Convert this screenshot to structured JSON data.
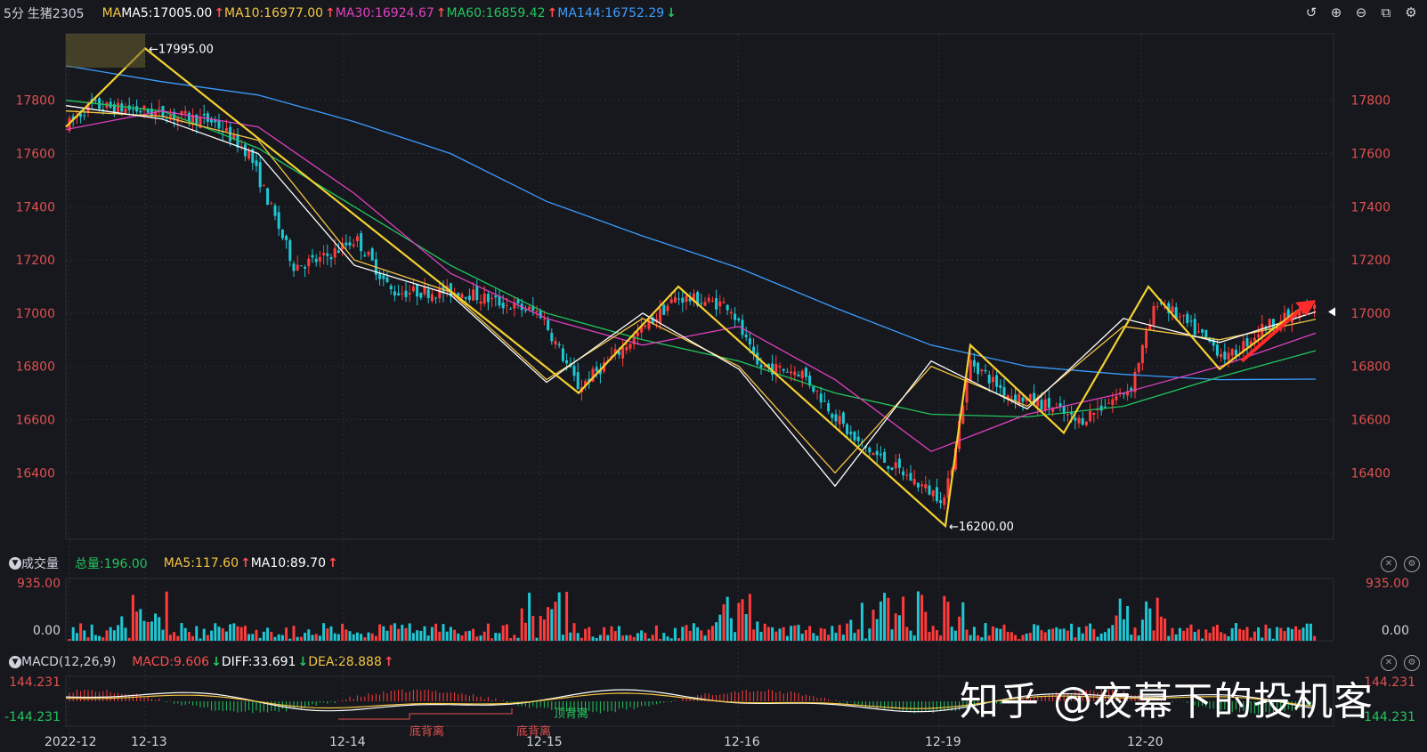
{
  "header": {
    "interval": "5分",
    "symbol": "生猪2305",
    "ma_label": "MA",
    "ma5": "MA5:17005.00",
    "ma10": "MA10:16977.00",
    "ma30": "MA30:16924.67",
    "ma60": "MA60:16859.42",
    "ma144": "MA144:16752.29",
    "ma5_dir": "↑",
    "ma10_dir": "↑",
    "ma30_dir": "↑",
    "ma60_dir": "↑",
    "ma144_dir": "↓"
  },
  "toolbar": {
    "undo_icon": "↺",
    "zoom_in_icon": "⊕",
    "zoom_out_icon": "⊖",
    "layout_icon": "⧉",
    "settings_icon": "⚙"
  },
  "volume_panel": {
    "title": "成交量",
    "total": "总量:196.00",
    "ma5": "MA5:117.60",
    "ma10": "MA10:89.70",
    "ma5_dir": "↑",
    "ma10_dir": "↑",
    "ytop": "935.00",
    "ybottom": "0.00"
  },
  "macd_panel": {
    "title": "MACD(12,26,9)",
    "macd": "MACD:9.606",
    "diff": "DIFF:33.691",
    "dea": "DEA:28.888",
    "macd_dir": "↓",
    "diff_dir": "↓",
    "dea_dir": "↑",
    "ytop": "144.231",
    "ybottom": "-144.231",
    "annotations": [
      "底背离",
      "底背离",
      "顶背离"
    ]
  },
  "price_annotations": {
    "high": "17995.00",
    "low": "16200.00"
  },
  "watermark": "知乎 @夜幕下的投机客",
  "chart_data": {
    "type": "line",
    "title": "生猪2305 5分",
    "y_ticks": [
      17800,
      17600,
      17400,
      17200,
      17000,
      16800,
      16600,
      16400
    ],
    "ylim": [
      16200,
      17995
    ],
    "x_ticks": [
      "2022-12",
      "12-13",
      "12-14",
      "12-15",
      "12-16",
      "12-19",
      "12-20"
    ],
    "zigzag": {
      "x": [
        "12-12 start",
        "12-13 high",
        "12-15 low",
        "12-15 high",
        "12-16 low",
        "12-19 low",
        "12-19 high",
        "12-19 low2",
        "12-20 high",
        "12-20 low",
        "12-20 end"
      ],
      "values": [
        17700,
        17995,
        16700,
        17100,
        16200,
        16200,
        16880,
        16550,
        17100,
        16790,
        17040
      ]
    },
    "series": [
      {
        "name": "MA144",
        "color": "#3b9cff",
        "values": [
          17930,
          17870,
          17820,
          17720,
          17600,
          17420,
          17290,
          17170,
          17020,
          16880,
          16800,
          16770,
          16750,
          16752
        ]
      },
      {
        "name": "MA60",
        "color": "#22c55e",
        "values": [
          17800,
          17760,
          17620,
          17400,
          17180,
          17000,
          16900,
          16820,
          16700,
          16620,
          16610,
          16650,
          16760,
          16859
        ]
      },
      {
        "name": "MA30",
        "color": "#e040c0",
        "values": [
          17690,
          17760,
          17700,
          17450,
          17150,
          16980,
          16880,
          16950,
          16750,
          16480,
          16620,
          16700,
          16800,
          16925
        ]
      },
      {
        "name": "MA10",
        "color": "#f5c542",
        "values": [
          17760,
          17740,
          17650,
          17200,
          17080,
          16750,
          16980,
          16800,
          16400,
          16800,
          16650,
          16950,
          16900,
          16977
        ]
      },
      {
        "name": "MA5",
        "color": "#ffffff",
        "values": [
          17780,
          17730,
          17600,
          17180,
          17070,
          16740,
          17000,
          16790,
          16350,
          16820,
          16640,
          16980,
          16890,
          17005
        ]
      }
    ],
    "colors": {
      "up": "#ff3b3b",
      "down": "#1fc7d4",
      "background": "#16181d",
      "grid": "#2a2e36",
      "zigzag": "#f5d130"
    }
  }
}
